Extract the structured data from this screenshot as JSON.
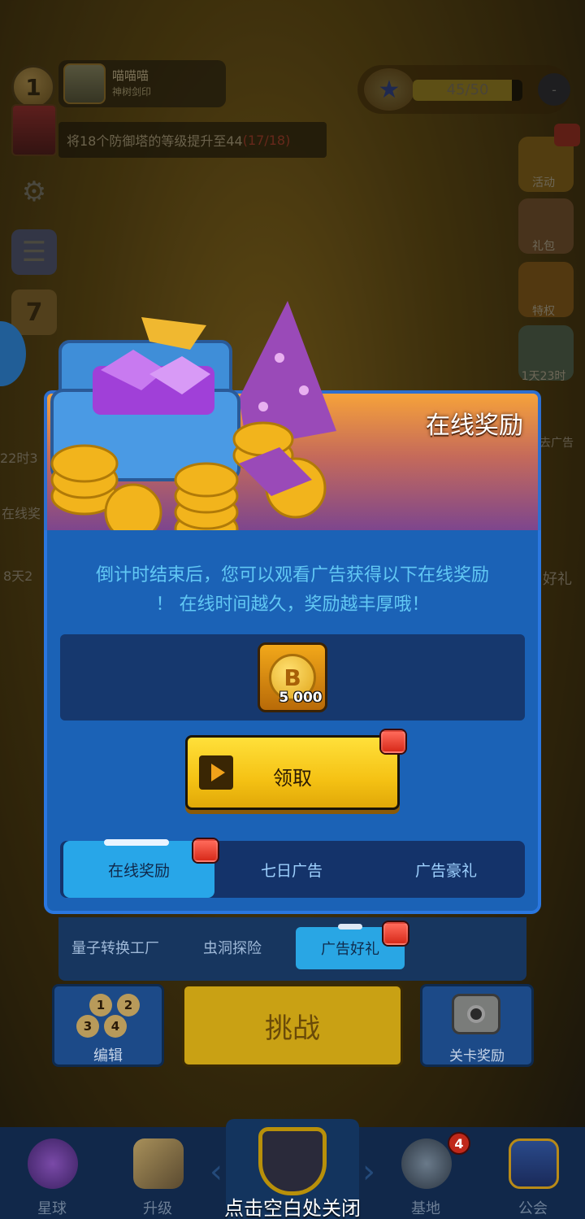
{
  "hud": {
    "player_level": "1",
    "player_name": "喵喵喵",
    "player_title": "神树剑印",
    "task_text_prefix": "将18个防御塔的等级提升至44",
    "task_progress": "(17/18)",
    "star_progress": "45/50",
    "star_progress_fraction": 0.9,
    "calendar_day": "7",
    "right_labels": [
      "活动",
      "礼包",
      "特权",
      "1天23时"
    ],
    "side_timers": [
      "22时3",
      "在线奖",
      "8天2"
    ],
    "right_side_texts": [
      "去广告",
      "好礼"
    ]
  },
  "modal": {
    "title": "在线奖励",
    "description_line1": "倒计时结束后，您可以观看广告获得以下在线奖励",
    "description_line2": "！ 在线时间越久，奖励越丰厚哦！",
    "reward": {
      "icon": "coin-icon",
      "quantity": "5 000",
      "coin_letter": "B"
    },
    "claim_label": "领取",
    "tabs": [
      {
        "label": "在线奖励",
        "active": true,
        "badge": true
      },
      {
        "label": "七日广告",
        "active": false,
        "badge": false
      },
      {
        "label": "广告豪礼",
        "active": false,
        "badge": false
      }
    ]
  },
  "lower_panel": {
    "sub_tabs": [
      "量子转换工厂",
      "虫洞探险",
      "广告好礼"
    ],
    "edit_label": "编辑",
    "hex_numbers": [
      "1",
      "2",
      "3",
      "4"
    ],
    "challenge_label": "挑战",
    "stage_reward_label": "关卡奖励"
  },
  "bottom_nav": {
    "items": [
      "星球",
      "升级",
      "基地",
      "公会"
    ],
    "base_badge": "4",
    "close_hint": "点击空白处关闭"
  },
  "colors": {
    "modal_blue": "#1b62b6",
    "claim_yellow": "#f5c214",
    "active_tab": "#28a6e8",
    "badge_red": "#d82a1a"
  }
}
